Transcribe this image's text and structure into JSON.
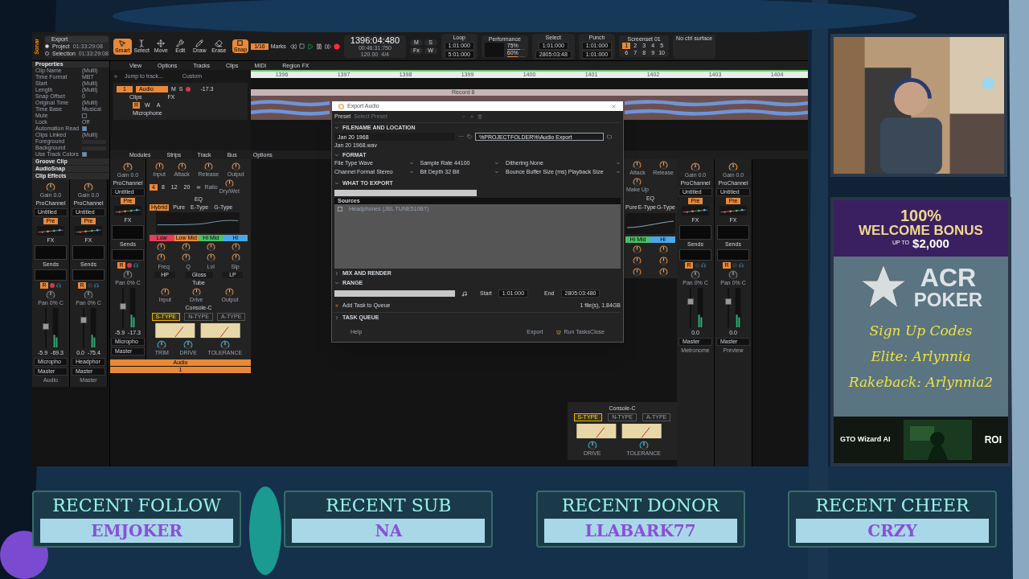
{
  "daw": {
    "logo": "Sonar",
    "export_button": "Export",
    "position_modes": [
      {
        "label": "Project",
        "time": "01:33:29:08",
        "selected": true
      },
      {
        "label": "Selection",
        "time": "01:33:29:08",
        "selected": false
      }
    ],
    "tools": [
      {
        "label": "Smart",
        "selected": true
      },
      {
        "label": "Select",
        "selected": false
      },
      {
        "label": "Move",
        "selected": false
      },
      {
        "label": "Edit",
        "selected": false
      },
      {
        "label": "Draw",
        "selected": false
      },
      {
        "label": "Erase",
        "selected": false
      }
    ],
    "snap": {
      "label": "Snap",
      "on": true,
      "value": "1/16"
    },
    "marks": "Marks",
    "now_time": "1396:04:480",
    "now_time_sub": "00:46:31:750",
    "tempo": "120.00",
    "meter": "4/4",
    "loop": {
      "label": "Loop",
      "start": "1:01:000",
      "end": "5:01:000"
    },
    "performance": {
      "label": "Performance",
      "meters": [
        {
          "reading": "75%",
          "level": 0.75
        },
        {
          "reading": "60%",
          "level": 0.6
        }
      ]
    },
    "select": {
      "label": "Select",
      "start": "1:01:000",
      "end": "2805:03:48"
    },
    "punch": {
      "label": "Punch",
      "start": "1:01:000",
      "end": "1:01:000"
    },
    "screenset": {
      "label": "Screenset 01",
      "slots": [
        {
          "label": "1",
          "selected": true
        },
        {
          "label": "2",
          "selected": false
        },
        {
          "label": "3",
          "selected": false
        },
        {
          "label": "4",
          "selected": false
        },
        {
          "label": "5",
          "selected": false
        },
        {
          "label": "6",
          "selected": false
        },
        {
          "label": "7",
          "selected": false
        },
        {
          "label": "8",
          "selected": false
        },
        {
          "label": "9",
          "selected": false
        },
        {
          "label": "10",
          "selected": false
        }
      ]
    },
    "control_surface": "No ctrl surface",
    "mix_buttons": [
      {
        "label": "M",
        "on": false
      },
      {
        "label": "S",
        "on": false
      },
      {
        "label": "Fx",
        "on": false
      },
      {
        "label": "W",
        "on": false
      }
    ],
    "menus": [
      "View",
      "Options",
      "Tracks",
      "Clips",
      "MIDI",
      "Region FX"
    ],
    "jump_placeholder": "Jump to track...",
    "track_view": "Custom",
    "ruler": [
      "1396",
      "1397",
      "1398",
      "1399",
      "1400",
      "1401",
      "1402",
      "1403",
      "1404"
    ],
    "track": {
      "number": "1",
      "name": "Audio",
      "mute": "M",
      "solo": "S",
      "armed": true,
      "volume": "-17.3",
      "lane": "Clips",
      "fx": "FX",
      "automation": [
        "R",
        "W",
        "A"
      ],
      "input": "Microphone"
    },
    "clip_name": "Record 8",
    "inspector": {
      "title": "Properties",
      "rows": [
        {
          "kind": "value",
          "label": "Clip Name",
          "value": "(Multi)"
        },
        {
          "kind": "value",
          "label": "Time Format",
          "value": "MBT"
        },
        {
          "kind": "value",
          "label": "Start",
          "value": "(Multi)"
        },
        {
          "kind": "value",
          "label": "Length",
          "value": "(Multi)"
        },
        {
          "kind": "value",
          "label": "Snap Offset",
          "value": "0"
        },
        {
          "kind": "value",
          "label": "Original Time",
          "value": "(Multi)"
        },
        {
          "kind": "value",
          "label": "Time Base",
          "value": "Musical"
        },
        {
          "kind": "check",
          "label": "Mute",
          "checked": false
        },
        {
          "kind": "value",
          "label": "Lock",
          "value": "Off"
        },
        {
          "kind": "check",
          "label": "Automation Read",
          "checked": true
        },
        {
          "kind": "value",
          "label": "Clips Linked",
          "value": "(Multi)"
        },
        {
          "kind": "swatch",
          "label": "Foreground"
        },
        {
          "kind": "swatch",
          "label": "Background"
        },
        {
          "kind": "check",
          "label": "Use Track Colors",
          "checked": true
        }
      ],
      "sections": [
        "Groove Clip",
        "AudioSnap",
        "Clip Effects"
      ]
    },
    "console_menus": [
      "Modules",
      "Strips",
      "Track",
      "Bus",
      "Options"
    ],
    "strips": [
      {
        "gain": "Gain 0.0",
        "prochannel": "ProChannel",
        "preset": "Untitled",
        "pre": "Pre",
        "fx": "FX",
        "sends": "Sends",
        "read": "R",
        "pan": "Pan 0% C",
        "peak": "-5.9",
        "rms": "-69.3",
        "input": "Micropho",
        "output": "Master",
        "name": "Audio",
        "level": 0.55,
        "armed": true
      },
      {
        "gain": "Gain 0.0",
        "prochannel": "ProChannel",
        "preset": "Untitled",
        "pre": "Pre",
        "fx": "FX",
        "sends": "Sends",
        "read": "R",
        "pan": "Pan 0% C",
        "peak": "0.0",
        "rms": "-75.4",
        "input": "Headphor",
        "output": "Master",
        "name": "Master",
        "level": 0.75,
        "armed": false
      },
      {
        "gain": "Gain 0.0",
        "prochannel": "ProChannel",
        "preset": "Untitled",
        "pre": "Pre",
        "fx": "FX",
        "sends": "Sends",
        "read": "R",
        "pan": "Pan 0% C",
        "peak": "-5.9",
        "rms": "-17.3",
        "input": "Micropho",
        "output": "Master",
        "level": 0.55,
        "armed": true
      }
    ],
    "strip_footer": [
      "Audio",
      "1"
    ],
    "prochannel": {
      "compressor": {
        "knobs": [
          "Input",
          "Attack",
          "Release",
          "Output"
        ],
        "ratio_label": "Ratio",
        "ratios": [
          {
            "label": "4",
            "selected": true
          },
          {
            "label": "8",
            "selected": false
          },
          {
            "label": "12",
            "selected": false
          },
          {
            "label": "20",
            "selected": false
          },
          {
            "label": "∞",
            "selected": false
          }
        ],
        "mix": "Dry/Wet"
      },
      "eq": {
        "title": "EQ",
        "modes": [
          {
            "label": "Hybrid",
            "selected": true
          },
          {
            "label": "Pure",
            "selected": false
          },
          {
            "label": "E-Type",
            "selected": false
          },
          {
            "label": "G-Type",
            "selected": false
          }
        ],
        "bands": [
          {
            "label": "Low",
            "color": "#e0405a"
          },
          {
            "label": "Low Mid",
            "color": "#e8893a"
          },
          {
            "label": "Hi Mid",
            "color": "#4cc06a"
          },
          {
            "label": "Hi",
            "color": "#4aa8e8"
          }
        ],
        "params": [
          "Freq",
          "Q",
          "Lvl",
          "Slp"
        ],
        "filters": [
          "HP",
          "Gloss",
          "LP"
        ]
      },
      "tube": {
        "title": "Tube",
        "knobs": [
          "Input",
          "Drive",
          "Output"
        ]
      },
      "console": {
        "title": "Console-C",
        "types": [
          {
            "label": "S-TYPE",
            "selected": true
          },
          {
            "label": "N-TYPE",
            "selected": false
          },
          {
            "label": "A-TYPE",
            "selected": false
          }
        ],
        "knobs": [
          "TRIM",
          "DRIVE",
          "TOLERANCE"
        ]
      }
    },
    "side_prochannel": {
      "knobs": [
        "Attack",
        "Release",
        "Make Up"
      ],
      "eq_title": "EQ",
      "modes": [
        {
          "label": "Pure",
          "selected": false
        },
        {
          "label": "E-Type",
          "selected": false
        },
        {
          "label": "G-Type",
          "selected": false
        }
      ],
      "bands": [
        {
          "label": "Hi Mid",
          "color": "#4cc06a"
        },
        {
          "label": "Hi",
          "color": "#4aa8e8"
        }
      ]
    },
    "side_console": {
      "title": "Console-C",
      "types": [
        {
          "label": "S-TYPE",
          "selected": true
        },
        {
          "label": "N-TYPE",
          "selected": false
        },
        {
          "label": "A-TYPE",
          "selected": false
        }
      ],
      "knobs": [
        "DRIVE",
        "TOLERANCE"
      ]
    },
    "side_strips": [
      {
        "gain": "Gain 0.0",
        "prochannel": "ProChannel",
        "preset": "Untitled",
        "pre": "Pre",
        "fx": "FX",
        "sends": "Sends",
        "read": "R",
        "pan": "Pan 0% C",
        "peak": "0.0",
        "output": "Master",
        "name": "Metronome",
        "level": 0.7,
        "armed": false
      },
      {
        "gain": "Gain 0.0",
        "prochannel": "ProChannel",
        "preset": "Untitled",
        "pre": "Pre",
        "fx": "FX",
        "sends": "Sends",
        "read": "R",
        "pan": "Pan 0% C",
        "peak": "0.0",
        "output": "Master",
        "name": "Preview",
        "level": 0.7,
        "armed": false
      }
    ]
  },
  "export_dialog": {
    "title": "Export Audio",
    "preset_label": "Preset",
    "preset_placeholder": "Select Preset",
    "filename_section": {
      "title": "FILENAME AND LOCATION",
      "expanded": true
    },
    "filename": "Jan 20 1968",
    "more_button": "···",
    "file_preview": "Jan 20 1968.wav",
    "folder": "%PROJECTFOLDER%\\Audio Export",
    "format_section": {
      "title": "FORMAT",
      "expanded": true
    },
    "format_fields": [
      "File Type Wave",
      "Sample Rate 44100",
      "Dithering None",
      "Channel Format Stereo",
      "Bit Depth 32 Bit",
      "Bounce Buffer Size (ms) Playback Size"
    ],
    "what_section": {
      "title": "WHAT TO EXPORT",
      "expanded": true
    },
    "sources_header": "Sources",
    "sources": [
      {
        "label": "Headphones (JBL TUNE510BT)",
        "checked": false
      }
    ],
    "mix_section": {
      "title": "MIX AND RENDER",
      "expanded": false
    },
    "range_section": {
      "title": "RANGE",
      "expanded": true
    },
    "start_label": "Start",
    "start": "1:01:000",
    "end_label": "End",
    "end": "2805:03:480",
    "add_task": "Add Task to Queue",
    "summary": "1 file(s), 1.84GB",
    "queue_section": {
      "title": "TASK QUEUE",
      "expanded": false
    },
    "buttons": [
      {
        "label": "Help",
        "kind": "plain"
      },
      {
        "label": "Export",
        "kind": "plain"
      },
      {
        "label": "Run Tasks",
        "kind": "crown"
      },
      {
        "label": "Close",
        "kind": "plain"
      }
    ]
  },
  "sponsor": {
    "bonus_percent": "100%",
    "bonus_title": "WELCOME BONUS",
    "bonus_up_to": "UP TO",
    "bonus_amount": "$2,000",
    "brand_top": "ACR",
    "brand_bottom": "POKER",
    "codes": [
      "Sign Up Codes",
      "Elite: Arlynnia",
      "Rakeback: Arlynnia2"
    ],
    "banner_title": "GTO Wizard AI",
    "banner_badge": "ROI"
  },
  "stream_bar": [
    {
      "title": "RECENT FOLLOW",
      "name": "EMJOKER"
    },
    {
      "title": "RECENT SUB",
      "name": "NA"
    },
    {
      "title": "RECENT DONOR",
      "name": "LLABARK77"
    },
    {
      "title": "RECENT CHEER",
      "name": "CRZY"
    }
  ]
}
